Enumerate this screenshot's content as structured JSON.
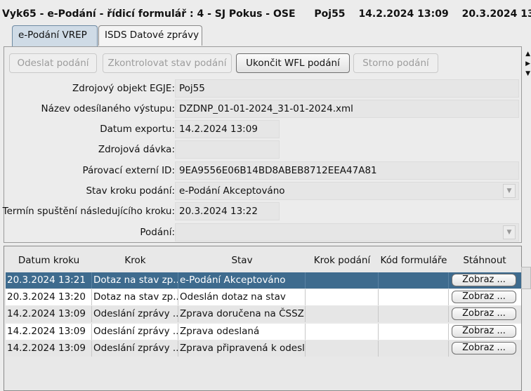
{
  "window": {
    "title_main": "Vyk65 - e-Podání - řídicí formulář : 4 - SJ Pokus - OSE",
    "title_code": "Poj55",
    "title_date1": "14.2.2024 13:09",
    "title_date2": "20.3.2024 13:21"
  },
  "tabs": [
    {
      "label": "e-Podání VREP",
      "active": true
    },
    {
      "label": "ISDS Datové zprávy",
      "active": false
    }
  ],
  "toolbar": {
    "send_label": "Odeslat podání",
    "check_label": "Zkontrolovat stav podání",
    "end_wfl_label": "Ukončit WFL podání",
    "storno_label": "Storno podání"
  },
  "form": {
    "source_label": "Zdrojový objekt EGJE:",
    "source_value": "Poj55",
    "output_label": "Název odesílaného výstupu:",
    "output_value": "DZDNP_01-01-2024_31-01-2024.xml",
    "export_label": "Datum exportu:",
    "export_value": "14.2.2024 13:09",
    "batch_label": "Zdrojová dávka:",
    "batch_value": "",
    "pairing_label": "Párovací externí ID:",
    "pairing_value": "9EA9556E06B14BD8ABEB8712EEA47A81",
    "state_label": "Stav kroku podání:",
    "state_value": "e-Podání Akceptováno",
    "next_label": "Termín spuštění následujícího kroku:",
    "next_value": "20.3.2024 13:22",
    "filing_label": "Podání:",
    "filing_value": ""
  },
  "grid": {
    "headers": [
      "Datum kroku",
      "Krok",
      "Stav",
      "Krok podání",
      "Kód formuláře",
      "Stáhnout"
    ],
    "button_label": "Zobraz ...",
    "rows": [
      {
        "date": "20.3.2024 13:21",
        "step": "Dotaz na stav zp...",
        "state": "e-Podání Akceptováno",
        "filing_step": "",
        "form_code": ""
      },
      {
        "date": "20.3.2024 13:20",
        "step": "Dotaz na stav zp...",
        "state": "Odeslán dotaz na stav",
        "filing_step": "",
        "form_code": ""
      },
      {
        "date": "14.2.2024 13:09",
        "step": "Odeslání zprávy ...",
        "state": "Zprava doručena na ČSSZ",
        "filing_step": "",
        "form_code": ""
      },
      {
        "date": "14.2.2024 13:09",
        "step": "Odeslání zprávy ...",
        "state": "Zprava odeslaná",
        "filing_step": "",
        "form_code": ""
      },
      {
        "date": "14.2.2024 13:09",
        "step": "Odeslání zprávy ...",
        "state": "Zprava připravená k odesl...",
        "filing_step": "",
        "form_code": ""
      }
    ]
  }
}
